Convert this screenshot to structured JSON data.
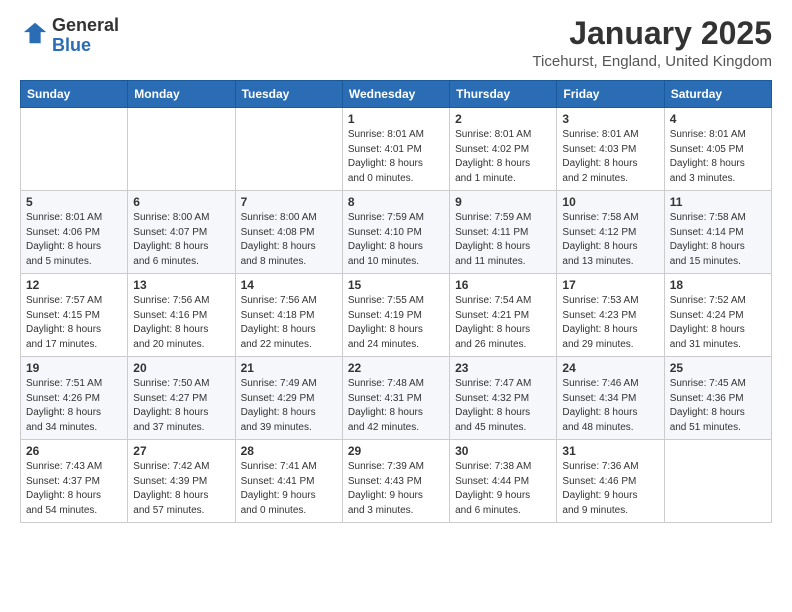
{
  "header": {
    "logo_general": "General",
    "logo_blue": "Blue",
    "title": "January 2025",
    "subtitle": "Ticehurst, England, United Kingdom"
  },
  "weekdays": [
    "Sunday",
    "Monday",
    "Tuesday",
    "Wednesday",
    "Thursday",
    "Friday",
    "Saturday"
  ],
  "weeks": [
    [
      {
        "day": "",
        "info": ""
      },
      {
        "day": "",
        "info": ""
      },
      {
        "day": "",
        "info": ""
      },
      {
        "day": "1",
        "info": "Sunrise: 8:01 AM\nSunset: 4:01 PM\nDaylight: 8 hours\nand 0 minutes."
      },
      {
        "day": "2",
        "info": "Sunrise: 8:01 AM\nSunset: 4:02 PM\nDaylight: 8 hours\nand 1 minute."
      },
      {
        "day": "3",
        "info": "Sunrise: 8:01 AM\nSunset: 4:03 PM\nDaylight: 8 hours\nand 2 minutes."
      },
      {
        "day": "4",
        "info": "Sunrise: 8:01 AM\nSunset: 4:05 PM\nDaylight: 8 hours\nand 3 minutes."
      }
    ],
    [
      {
        "day": "5",
        "info": "Sunrise: 8:01 AM\nSunset: 4:06 PM\nDaylight: 8 hours\nand 5 minutes."
      },
      {
        "day": "6",
        "info": "Sunrise: 8:00 AM\nSunset: 4:07 PM\nDaylight: 8 hours\nand 6 minutes."
      },
      {
        "day": "7",
        "info": "Sunrise: 8:00 AM\nSunset: 4:08 PM\nDaylight: 8 hours\nand 8 minutes."
      },
      {
        "day": "8",
        "info": "Sunrise: 7:59 AM\nSunset: 4:10 PM\nDaylight: 8 hours\nand 10 minutes."
      },
      {
        "day": "9",
        "info": "Sunrise: 7:59 AM\nSunset: 4:11 PM\nDaylight: 8 hours\nand 11 minutes."
      },
      {
        "day": "10",
        "info": "Sunrise: 7:58 AM\nSunset: 4:12 PM\nDaylight: 8 hours\nand 13 minutes."
      },
      {
        "day": "11",
        "info": "Sunrise: 7:58 AM\nSunset: 4:14 PM\nDaylight: 8 hours\nand 15 minutes."
      }
    ],
    [
      {
        "day": "12",
        "info": "Sunrise: 7:57 AM\nSunset: 4:15 PM\nDaylight: 8 hours\nand 17 minutes."
      },
      {
        "day": "13",
        "info": "Sunrise: 7:56 AM\nSunset: 4:16 PM\nDaylight: 8 hours\nand 20 minutes."
      },
      {
        "day": "14",
        "info": "Sunrise: 7:56 AM\nSunset: 4:18 PM\nDaylight: 8 hours\nand 22 minutes."
      },
      {
        "day": "15",
        "info": "Sunrise: 7:55 AM\nSunset: 4:19 PM\nDaylight: 8 hours\nand 24 minutes."
      },
      {
        "day": "16",
        "info": "Sunrise: 7:54 AM\nSunset: 4:21 PM\nDaylight: 8 hours\nand 26 minutes."
      },
      {
        "day": "17",
        "info": "Sunrise: 7:53 AM\nSunset: 4:23 PM\nDaylight: 8 hours\nand 29 minutes."
      },
      {
        "day": "18",
        "info": "Sunrise: 7:52 AM\nSunset: 4:24 PM\nDaylight: 8 hours\nand 31 minutes."
      }
    ],
    [
      {
        "day": "19",
        "info": "Sunrise: 7:51 AM\nSunset: 4:26 PM\nDaylight: 8 hours\nand 34 minutes."
      },
      {
        "day": "20",
        "info": "Sunrise: 7:50 AM\nSunset: 4:27 PM\nDaylight: 8 hours\nand 37 minutes."
      },
      {
        "day": "21",
        "info": "Sunrise: 7:49 AM\nSunset: 4:29 PM\nDaylight: 8 hours\nand 39 minutes."
      },
      {
        "day": "22",
        "info": "Sunrise: 7:48 AM\nSunset: 4:31 PM\nDaylight: 8 hours\nand 42 minutes."
      },
      {
        "day": "23",
        "info": "Sunrise: 7:47 AM\nSunset: 4:32 PM\nDaylight: 8 hours\nand 45 minutes."
      },
      {
        "day": "24",
        "info": "Sunrise: 7:46 AM\nSunset: 4:34 PM\nDaylight: 8 hours\nand 48 minutes."
      },
      {
        "day": "25",
        "info": "Sunrise: 7:45 AM\nSunset: 4:36 PM\nDaylight: 8 hours\nand 51 minutes."
      }
    ],
    [
      {
        "day": "26",
        "info": "Sunrise: 7:43 AM\nSunset: 4:37 PM\nDaylight: 8 hours\nand 54 minutes."
      },
      {
        "day": "27",
        "info": "Sunrise: 7:42 AM\nSunset: 4:39 PM\nDaylight: 8 hours\nand 57 minutes."
      },
      {
        "day": "28",
        "info": "Sunrise: 7:41 AM\nSunset: 4:41 PM\nDaylight: 9 hours\nand 0 minutes."
      },
      {
        "day": "29",
        "info": "Sunrise: 7:39 AM\nSunset: 4:43 PM\nDaylight: 9 hours\nand 3 minutes."
      },
      {
        "day": "30",
        "info": "Sunrise: 7:38 AM\nSunset: 4:44 PM\nDaylight: 9 hours\nand 6 minutes."
      },
      {
        "day": "31",
        "info": "Sunrise: 7:36 AM\nSunset: 4:46 PM\nDaylight: 9 hours\nand 9 minutes."
      },
      {
        "day": "",
        "info": ""
      }
    ]
  ]
}
